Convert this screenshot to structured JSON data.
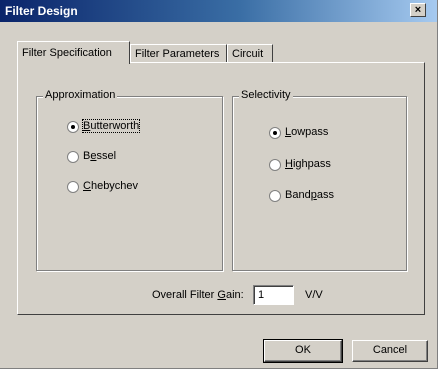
{
  "window": {
    "title": "Filter Design",
    "close_glyph": "×"
  },
  "tabs": [
    {
      "label": "Filter Specification",
      "active": true
    },
    {
      "label": "Filter Parameters",
      "active": false
    },
    {
      "label": "Circuit",
      "active": false
    }
  ],
  "approximation": {
    "title": "Approximation",
    "options": [
      {
        "pre": "",
        "key": "B",
        "post": "utterworth",
        "selected": true
      },
      {
        "pre": "B",
        "key": "e",
        "post": "ssel",
        "selected": false
      },
      {
        "pre": "",
        "key": "C",
        "post": "hebychev",
        "selected": false
      }
    ]
  },
  "selectivity": {
    "title": "Selectivity",
    "options": [
      {
        "pre": "",
        "key": "L",
        "post": "owpass",
        "selected": true
      },
      {
        "pre": "",
        "key": "H",
        "post": "ighpass",
        "selected": false
      },
      {
        "pre": "Band",
        "key": "p",
        "post": "ass",
        "selected": false
      }
    ]
  },
  "gain": {
    "label_pre": "Overall Filter ",
    "label_key": "G",
    "label_post": "ain:",
    "value": "1",
    "unit": "V/V"
  },
  "buttons": {
    "ok": "OK",
    "cancel": "Cancel"
  }
}
